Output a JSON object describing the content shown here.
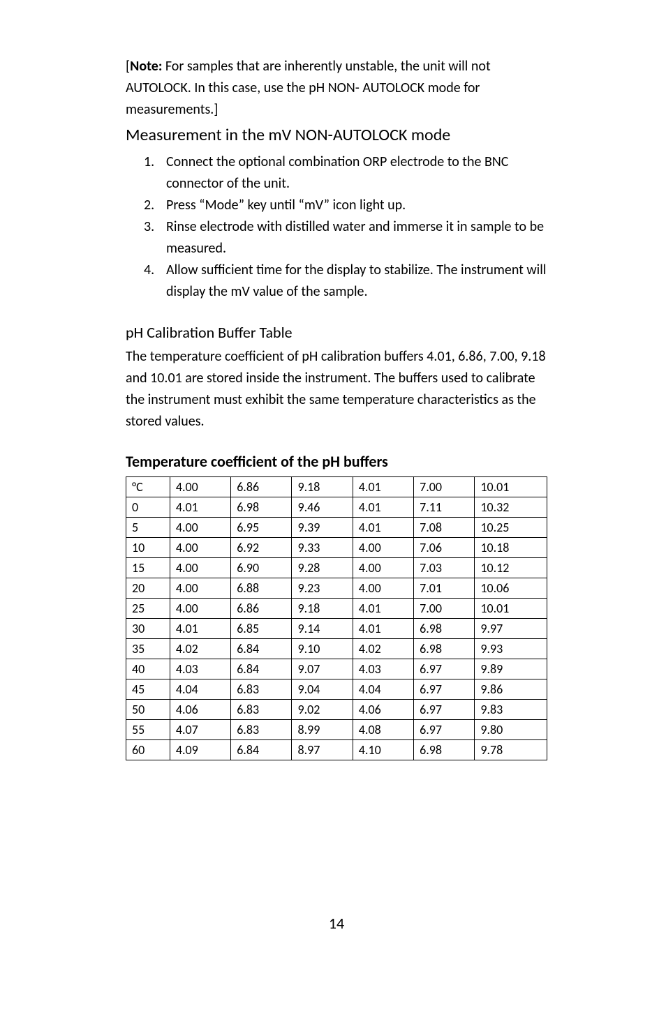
{
  "note": {
    "prefix": "[",
    "bold": "Note:",
    "rest": " For samples that are inherently unstable, the unit will not AUTOLOCK. In this case, use the pH NON- AUTOLOCK mode for measurements.]"
  },
  "section1": {
    "title": "Measurement in the mV NON-AUTOLOCK mode",
    "items": [
      {
        "n": "1.",
        "t": "Connect the optional combination ORP electrode to the BNC connector of the unit."
      },
      {
        "n": "2.",
        "t": "Press “Mode” key until “mV” icon light up."
      },
      {
        "n": "3.",
        "t": "Rinse electrode with distilled water and immerse it in sample to be measured."
      },
      {
        "n": "4.",
        "t": "Allow sufficient time for the display to stabilize. The instrument will display the mV value of the sample."
      }
    ]
  },
  "section2": {
    "title": "pH Calibration Buffer Table",
    "text": "The temperature coefficient of pH calibration buffers 4.01, 6.86, 7.00, 9.18 and 10.01 are stored inside the instrument. The buffers used to calibrate the instrument must exhibit the same temperature characteristics as the stored values."
  },
  "table": {
    "title": "Temperature coefficient of the pH buffers",
    "header": [
      "°C",
      "4.00",
      "6.86",
      "9.18",
      "4.01",
      "7.00",
      "10.01"
    ],
    "rows": [
      [
        "0",
        "4.01",
        "6.98",
        "9.46",
        "4.01",
        "7.11",
        "10.32"
      ],
      [
        "5",
        "4.00",
        "6.95",
        "9.39",
        "4.01",
        "7.08",
        "10.25"
      ],
      [
        "10",
        "4.00",
        "6.92",
        "9.33",
        "4.00",
        "7.06",
        "10.18"
      ],
      [
        "15",
        "4.00",
        "6.90",
        "9.28",
        "4.00",
        "7.03",
        "10.12"
      ],
      [
        "20",
        "4.00",
        "6.88",
        "9.23",
        "4.00",
        "7.01",
        "10.06"
      ],
      [
        "25",
        "4.00",
        "6.86",
        "9.18",
        "4.01",
        "7.00",
        "10.01"
      ],
      [
        "30",
        "4.01",
        "6.85",
        "9.14",
        "4.01",
        "6.98",
        "9.97"
      ],
      [
        "35",
        "4.02",
        "6.84",
        "9.10",
        "4.02",
        "6.98",
        "9.93"
      ],
      [
        "40",
        "4.03",
        "6.84",
        "9.07",
        "4.03",
        "6.97",
        "9.89"
      ],
      [
        "45",
        "4.04",
        "6.83",
        "9.04",
        "4.04",
        "6.97",
        "9.86"
      ],
      [
        "50",
        "4.06",
        "6.83",
        "9.02",
        "4.06",
        "6.97",
        "9.83"
      ],
      [
        "55",
        "4.07",
        "6.83",
        "8.99",
        "4.08",
        "6.97",
        "9.80"
      ],
      [
        "60",
        "4.09",
        "6.84",
        "8.97",
        "4.10",
        "6.98",
        "9.78"
      ]
    ]
  },
  "pagenum": "14",
  "chart_data": {
    "type": "table",
    "title": "Temperature coefficient of the pH buffers",
    "columns": [
      "°C",
      "4.00",
      "6.86",
      "9.18",
      "4.01",
      "7.00",
      "10.01"
    ],
    "rows": [
      [
        0,
        4.01,
        6.98,
        9.46,
        4.01,
        7.11,
        10.32
      ],
      [
        5,
        4.0,
        6.95,
        9.39,
        4.01,
        7.08,
        10.25
      ],
      [
        10,
        4.0,
        6.92,
        9.33,
        4.0,
        7.06,
        10.18
      ],
      [
        15,
        4.0,
        6.9,
        9.28,
        4.0,
        7.03,
        10.12
      ],
      [
        20,
        4.0,
        6.88,
        9.23,
        4.0,
        7.01,
        10.06
      ],
      [
        25,
        4.0,
        6.86,
        9.18,
        4.01,
        7.0,
        10.01
      ],
      [
        30,
        4.01,
        6.85,
        9.14,
        4.01,
        6.98,
        9.97
      ],
      [
        35,
        4.02,
        6.84,
        9.1,
        4.02,
        6.98,
        9.93
      ],
      [
        40,
        4.03,
        6.84,
        9.07,
        4.03,
        6.97,
        9.89
      ],
      [
        45,
        4.04,
        6.83,
        9.04,
        4.04,
        6.97,
        9.86
      ],
      [
        50,
        4.06,
        6.83,
        9.02,
        4.06,
        6.97,
        9.83
      ],
      [
        55,
        4.07,
        6.83,
        8.99,
        4.08,
        6.97,
        9.8
      ],
      [
        60,
        4.09,
        6.84,
        8.97,
        4.1,
        6.98,
        9.78
      ]
    ]
  }
}
